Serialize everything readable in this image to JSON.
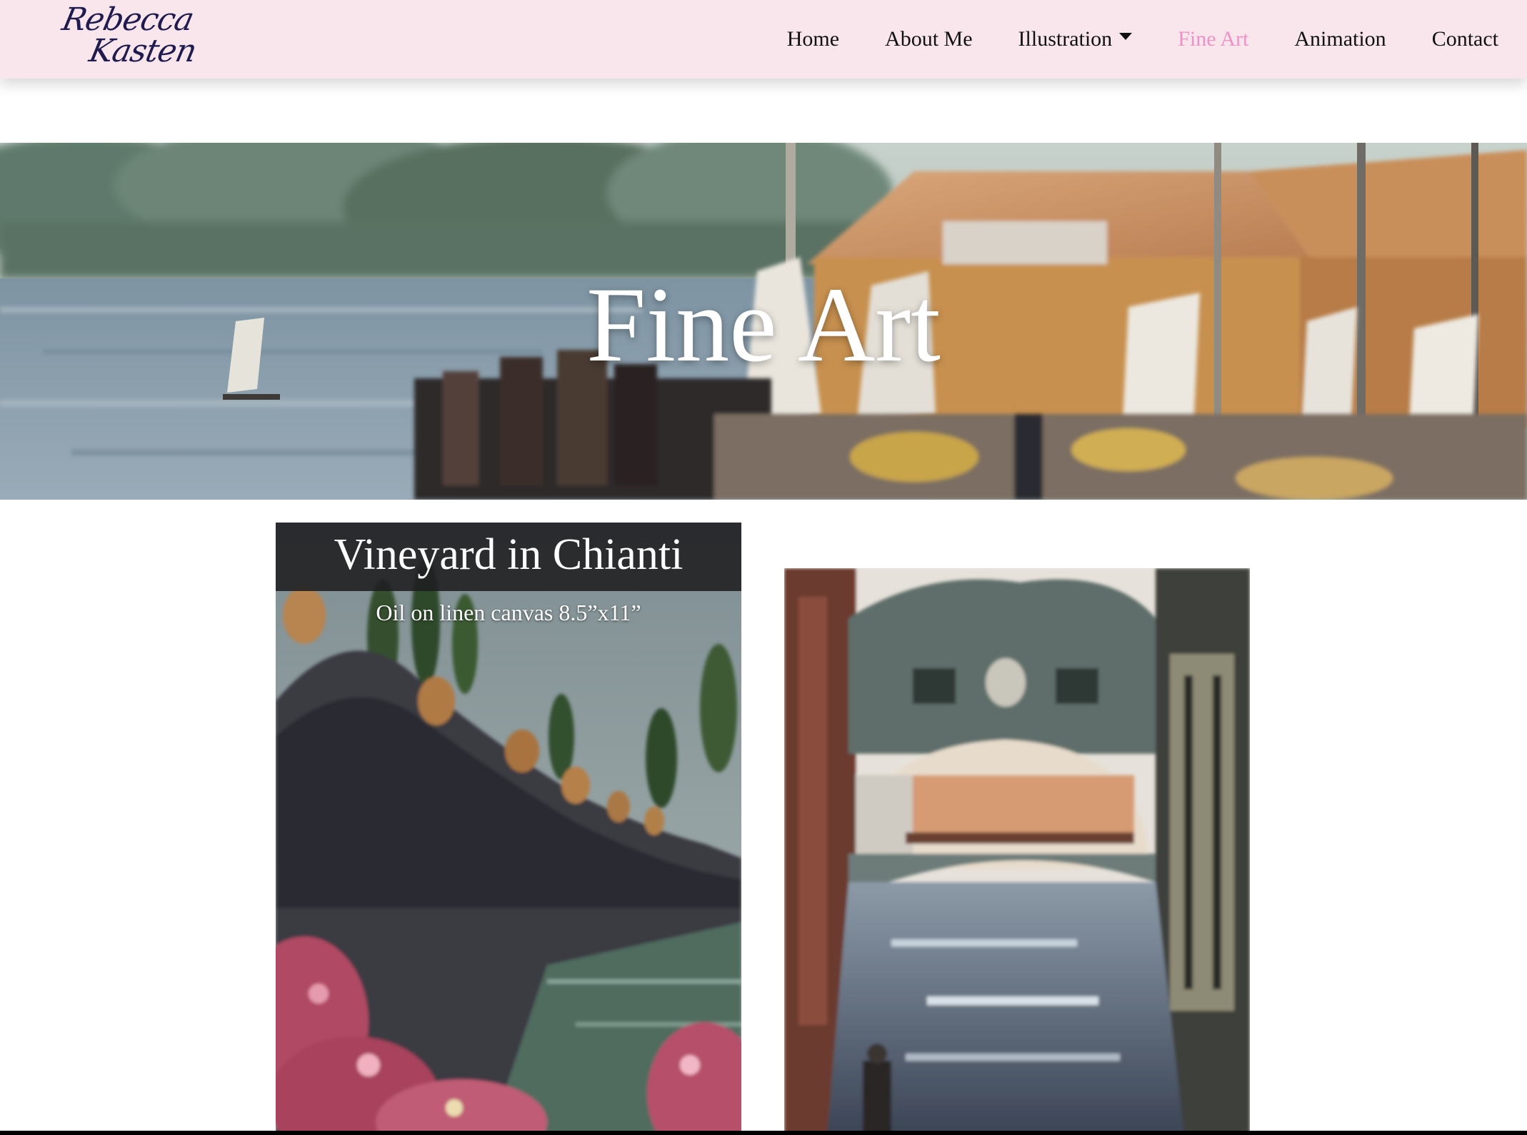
{
  "brand": {
    "logo_line1": "Rebecca",
    "logo_line2": "Kasten"
  },
  "nav": {
    "home": "Home",
    "about": "About Me",
    "illustration": "Illustration",
    "fine_art": "Fine Art",
    "animation": "Animation",
    "contact": "Contact",
    "active": "Fine Art",
    "active_color": "#ec92c4",
    "bar_color": "#f8e6ec"
  },
  "hero": {
    "title": "Fine Art"
  },
  "gallery": [
    {
      "title": "Vineyard in Chianti",
      "subtitle": "Oil on linen canvas 8.5”x11”"
    }
  ]
}
